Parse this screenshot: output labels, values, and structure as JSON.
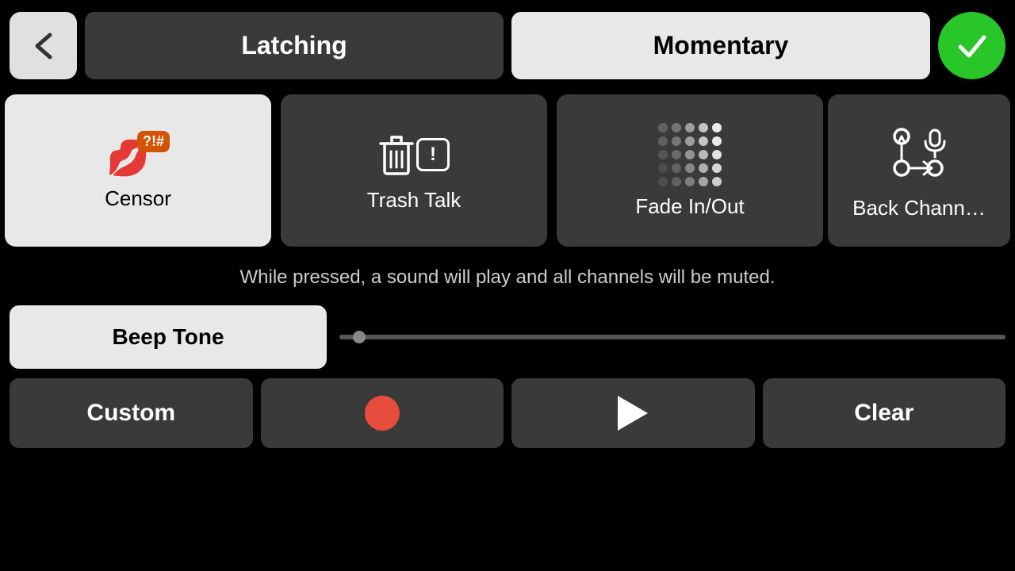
{
  "header": {
    "back_label": "‹",
    "tab_latching": "Latching",
    "tab_momentary": "Momentary"
  },
  "cards": [
    {
      "id": "censor",
      "label": "Censor",
      "active": true
    },
    {
      "id": "trash-talk",
      "label": "Trash Talk",
      "active": false
    },
    {
      "id": "fade-inout",
      "label": "Fade In/Out",
      "active": false
    },
    {
      "id": "back-channel",
      "label": "Back Chann…",
      "active": false
    }
  ],
  "description": "While pressed, a sound will play and all channels will be muted.",
  "beep_button_label": "Beep Tone",
  "actions": {
    "custom_label": "Custom",
    "record_label": "",
    "play_label": "",
    "clear_label": "Clear"
  }
}
